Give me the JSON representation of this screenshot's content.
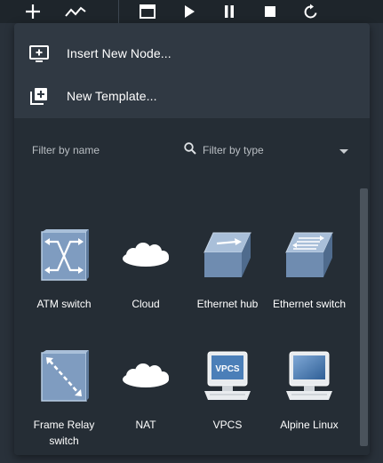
{
  "toolbar": {
    "buttons": [
      {
        "name": "add-icon"
      },
      {
        "name": "activity-icon"
      },
      {
        "name": "console-window-icon"
      },
      {
        "name": "play-icon"
      },
      {
        "name": "pause-icon"
      },
      {
        "name": "stop-icon"
      },
      {
        "name": "reload-icon"
      }
    ]
  },
  "menu": {
    "insert_node": "Insert New Node...",
    "new_template": "New Template..."
  },
  "filters": {
    "name_placeholder": "Filter by name",
    "type_placeholder": "Filter by type"
  },
  "nodes": [
    {
      "label": "ATM switch",
      "icon": "atm-switch-icon"
    },
    {
      "label": "Cloud",
      "icon": "cloud-icon"
    },
    {
      "label": "Ethernet hub",
      "icon": "ethernet-hub-icon"
    },
    {
      "label": "Ethernet switch",
      "icon": "ethernet-switch-icon"
    },
    {
      "label": "Frame Relay switch",
      "icon": "frame-relay-switch-icon"
    },
    {
      "label": "NAT",
      "icon": "nat-cloud-icon"
    },
    {
      "label": "VPCS",
      "icon": "vpcs-computer-icon"
    },
    {
      "label": "Alpine Linux",
      "icon": "alpine-linux-computer-icon"
    }
  ],
  "vpcs_screen_text": "VPCS",
  "colors": {
    "background": "#29313a",
    "panel": "#303943",
    "panel_dark": "#252d35",
    "device_blue": "#7f9cc0"
  }
}
